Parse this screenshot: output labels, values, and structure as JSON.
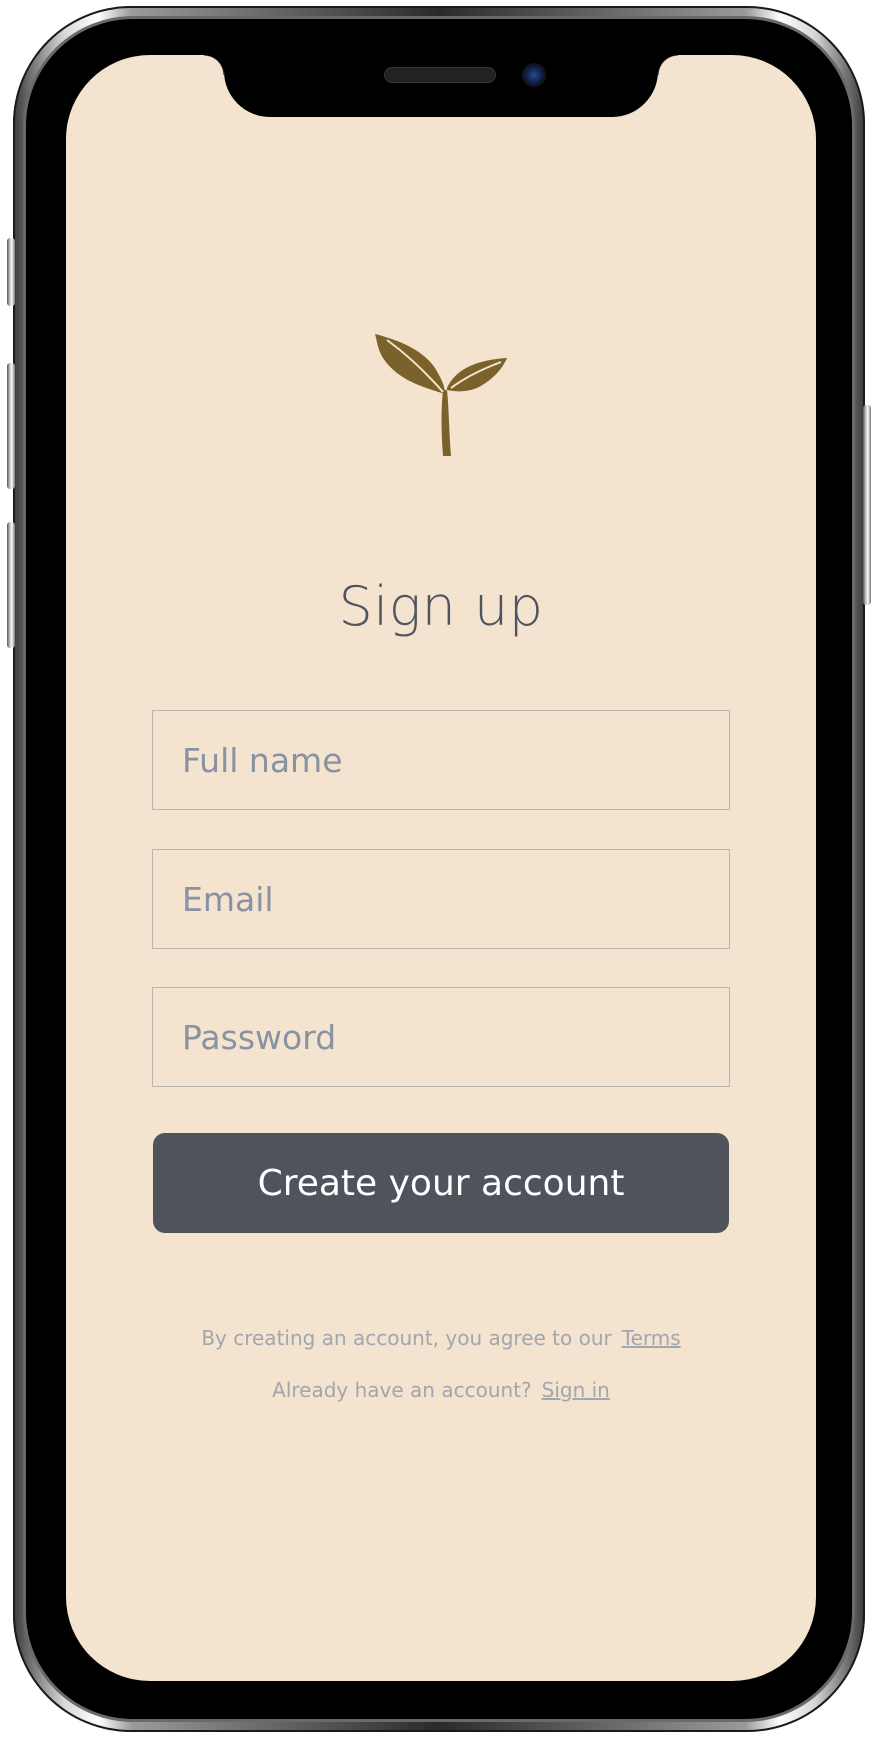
{
  "screen": {
    "background": "#f3e3cf",
    "title": "Sign up",
    "logo_icon": "sprout-icon",
    "logo_color": "#7a622a"
  },
  "form": {
    "full_name": {
      "placeholder": "Full name",
      "value": ""
    },
    "email": {
      "placeholder": "Email",
      "value": ""
    },
    "password": {
      "placeholder": "Password",
      "value": ""
    },
    "submit_label": "Create your account",
    "button_color": "#4f535c"
  },
  "footer": {
    "terms_text": "By creating an account, you agree to our",
    "terms_link": "Terms",
    "signin_text": "Already have an account?",
    "signin_link": "Sign in"
  }
}
